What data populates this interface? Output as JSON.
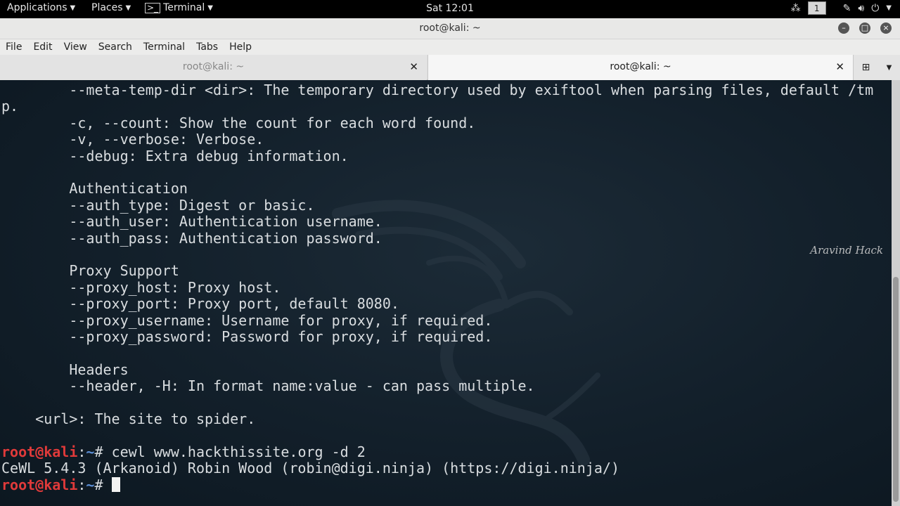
{
  "top_panel": {
    "applications": "Applications",
    "places": "Places",
    "terminal": "Terminal",
    "clock": "Sat 12:01",
    "workspace": "1",
    "icons": [
      "network-icon",
      "brush-icon",
      "volume-icon",
      "power-icon"
    ]
  },
  "window": {
    "title": "root@kali: ~",
    "controls": [
      "minimize-icon",
      "maximize-icon",
      "close-icon"
    ]
  },
  "menubar": [
    "File",
    "Edit",
    "View",
    "Search",
    "Terminal",
    "Tabs",
    "Help"
  ],
  "tabs": [
    {
      "label": "root@kali: ~",
      "active": false
    },
    {
      "label": "root@kali: ~",
      "active": true
    }
  ],
  "terminal": {
    "lines": [
      "        --meta-temp-dir <dir>: The temporary directory used by exiftool when parsing files, default /tm",
      "p.",
      "        -c, --count: Show the count for each word found.",
      "        -v, --verbose: Verbose.",
      "        --debug: Extra debug information.",
      "",
      "        Authentication",
      "        --auth_type: Digest or basic.",
      "        --auth_user: Authentication username.",
      "        --auth_pass: Authentication password.",
      "",
      "        Proxy Support",
      "        --proxy_host: Proxy host.",
      "        --proxy_port: Proxy port, default 8080.",
      "        --proxy_username: Username for proxy, if required.",
      "        --proxy_password: Password for proxy, if required.",
      "",
      "        Headers",
      "        --header, -H: In format name:value - can pass multiple.",
      "",
      "    <url>: The site to spider.",
      ""
    ],
    "prompt_user": "root@kali",
    "prompt_sep": ":",
    "prompt_dir": "~",
    "prompt_hash": "# ",
    "command": "cewl www.hackthissite.org -d 2",
    "output": "CeWL 5.4.3 (Arkanoid) Robin Wood (robin@digi.ninja) (https://digi.ninja/)",
    "watermark": "Aravind Hack"
  },
  "colors": {
    "prompt": "#e03a3a",
    "dir": "#5c8fd6",
    "background": "#13202b",
    "text": "#d9dde0"
  }
}
